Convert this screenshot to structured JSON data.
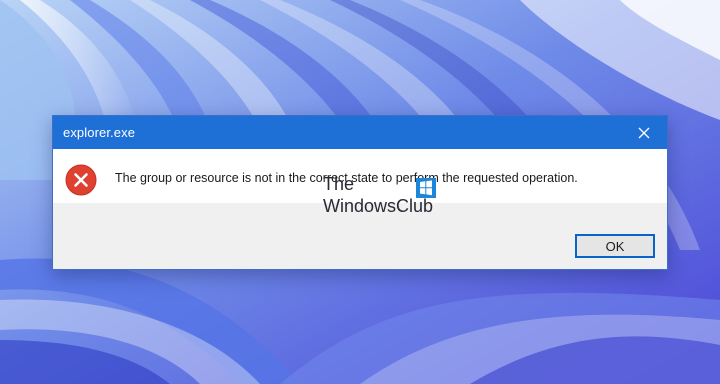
{
  "dialog": {
    "title": "explorer.exe",
    "message": "The group or resource is not in the correct state to perform the requested operation.",
    "ok_label": "OK",
    "icons": {
      "close": "close-icon",
      "error": "error-icon"
    }
  },
  "watermark": {
    "line1": "The",
    "line2": "WindowsClub"
  },
  "colors": {
    "titlebar": "#1e6fd6",
    "error_icon": "#e0402f",
    "dialog_footer": "#f0f0f0",
    "button_border": "#0a64c8"
  }
}
